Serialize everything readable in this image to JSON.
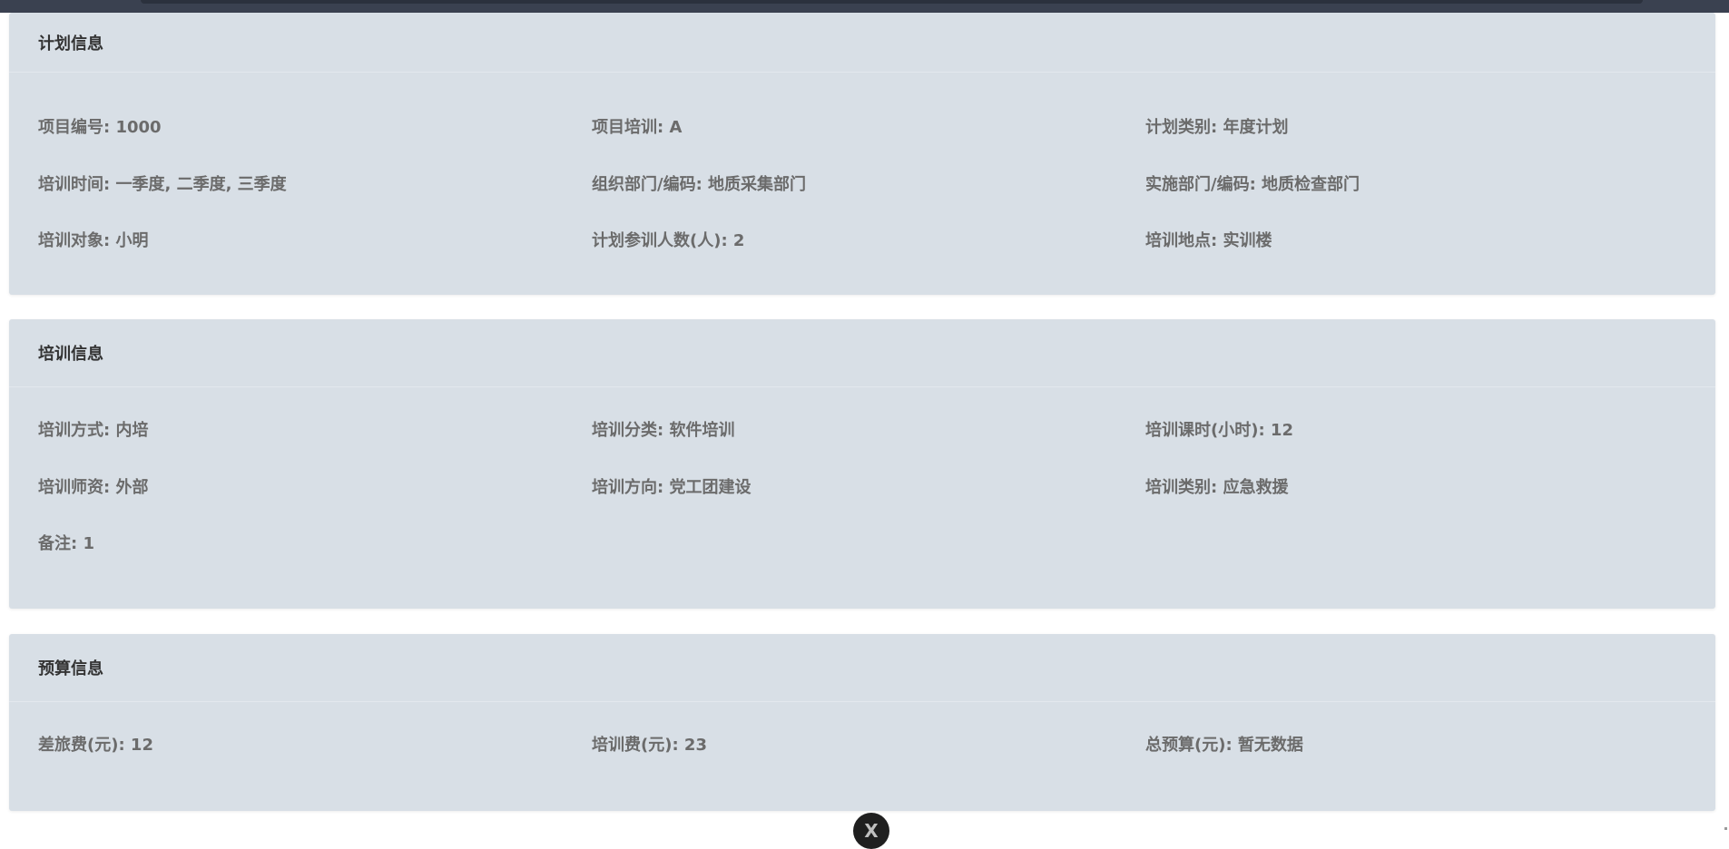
{
  "plan": {
    "title": "计划信息",
    "rows": [
      [
        "项目编号: 1000",
        "项目培训: A",
        "计划类别: 年度计划"
      ],
      [
        "培训时间: 一季度, 二季度, 三季度",
        "组织部门/编码: 地质采集部门",
        "实施部门/编码: 地质检查部门"
      ],
      [
        "培训对象: 小明",
        "计划参训人数(人): 2",
        "培训地点: 实训楼"
      ]
    ]
  },
  "training": {
    "title": "培训信息",
    "rows": [
      [
        "培训方式: 内培",
        "培训分类: 软件培训",
        "培训课时(小时): 12"
      ],
      [
        "培训师资: 外部",
        "培训方向: 党工团建设",
        "培训类别: 应急救援"
      ],
      [
        "备注: 1"
      ]
    ]
  },
  "budget": {
    "title": "预算信息",
    "rows": [
      [
        "差旅费(元): 12",
        "培训费(元): 23",
        "总预算(元): 暂无数据"
      ]
    ]
  },
  "close_button": {
    "label": "X",
    "icon": "close-icon"
  },
  "colors": {
    "card_bg": "#d8dfe6",
    "header_text": "#333333",
    "field_text": "#6b6b6b",
    "topbar": "#3a4150"
  }
}
